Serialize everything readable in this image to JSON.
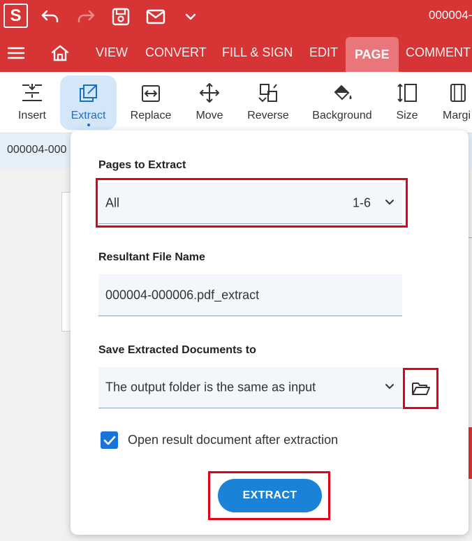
{
  "titlebar": {
    "logo": "S",
    "doc_title": "000004-0",
    "icons": [
      "undo-icon",
      "redo-icon",
      "save-icon",
      "mail-icon",
      "chevron-down-icon"
    ]
  },
  "menubar": {
    "tabs": [
      {
        "label": "VIEW"
      },
      {
        "label": "CONVERT"
      },
      {
        "label": "FILL & SIGN"
      },
      {
        "label": "EDIT"
      },
      {
        "label": "PAGE"
      },
      {
        "label": "COMMENT"
      }
    ],
    "active_tab": "PAGE"
  },
  "ribbon": {
    "tools": [
      {
        "label": "Insert"
      },
      {
        "label": "Extract"
      },
      {
        "label": "Replace"
      },
      {
        "label": "Move"
      },
      {
        "label": "Reverse"
      },
      {
        "label": "Background"
      },
      {
        "label": "Size"
      },
      {
        "label": "Margi"
      }
    ],
    "active_tool": "Extract"
  },
  "docstrip": {
    "tab_label": "000004-000"
  },
  "dialog": {
    "pages_label": "Pages to Extract",
    "pages_value": "All",
    "pages_range": "1-6",
    "filename_label": "Resultant File Name",
    "filename_value": "000004-000006.pdf_extract",
    "save_label": "Save Extracted Documents to",
    "save_value": "The output folder is the same as input",
    "open_after_label": "Open result document after extraction",
    "open_after_checked": true,
    "extract_button": "EXTRACT"
  },
  "colors": {
    "brand_red": "#d73535",
    "active_tab": "#e9767a",
    "accent_blue": "#1a83d8",
    "highlight_red": "#e5001a"
  }
}
